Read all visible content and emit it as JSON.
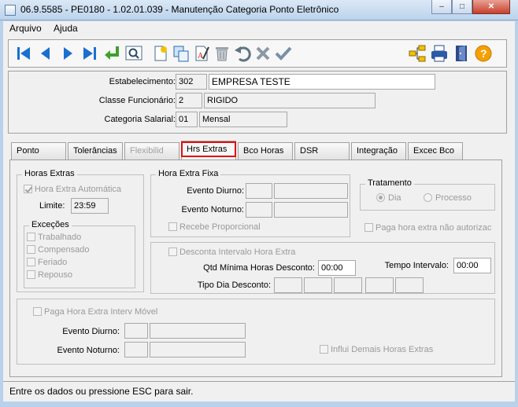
{
  "window": {
    "title": "06.9.5585 - PE0180 - 1.02.01.039 - Manutenção Categoria Ponto Eletrônico",
    "min_label": "–",
    "max_label": "□",
    "close_label": "✕"
  },
  "menu": {
    "items": [
      "Arquivo",
      "Ajuda"
    ]
  },
  "toolbar": {
    "icons": [
      "first-record-icon",
      "previous-record-icon",
      "next-record-icon",
      "last-record-icon",
      "return-icon",
      "zoom-icon",
      "new-record-icon",
      "copy-record-icon",
      "edit-record-icon",
      "delete-record-icon",
      "undo-icon",
      "cancel-icon",
      "confirm-icon",
      "tree-icon",
      "print-icon",
      "exit-icon",
      "help-icon"
    ]
  },
  "header": {
    "estabelecimento_label": "Estabelecimento:",
    "estabelecimento_code": "302",
    "estabelecimento_name": "EMPRESA TESTE",
    "classe_label": "Classe Funcionário:",
    "classe_code": "2",
    "classe_name": "RIGIDO",
    "categoria_label": "Categoria Salarial:",
    "categoria_code": "01",
    "categoria_name": "Mensal"
  },
  "tabs": [
    "Ponto",
    "Tolerâncias",
    "Flexibilid",
    "Hrs Extras",
    "Bco Horas",
    "DSR",
    "Integração",
    "Excec Bco"
  ],
  "panel": {
    "horas_extras": {
      "title": "Horas Extras",
      "automatica": "Hora Extra Automática",
      "limite_label": "Limite:",
      "limite_value": "23:59",
      "excecoes_title": "Exceções",
      "excecoes": [
        "Trabalhado",
        "Compensado",
        "Feriado",
        "Repouso"
      ]
    },
    "hora_extra_fixa": {
      "title": "Hora Extra Fixa",
      "evento_diurno": "Evento Diurno:",
      "evento_noturno": "Evento Noturno:",
      "recebe_proporcional": "Recebe Proporcional"
    },
    "tratamento": {
      "title": "Tratamento",
      "dia": "Dia",
      "processo": "Processo"
    },
    "paga_nao_autorizada": "Paga hora extra não autorizac",
    "desconta": {
      "title": "Desconta Intervalo Hora Extra",
      "qtd_label": "Qtd Mínima Horas Desconto:",
      "qtd_value": "00:00",
      "tempo_label": "Tempo Intervalo:",
      "tempo_value": "00:00",
      "tipo_label": "Tipo Dia Desconto:"
    },
    "movel": {
      "title": "Paga Hora Extra Interv Móvel",
      "evento_diurno": "Evento Diurno:",
      "evento_noturno": "Evento Noturno:",
      "influi": "Influi Demais Horas Extras"
    }
  },
  "status": "Entre os dados ou pressione ESC para sair."
}
